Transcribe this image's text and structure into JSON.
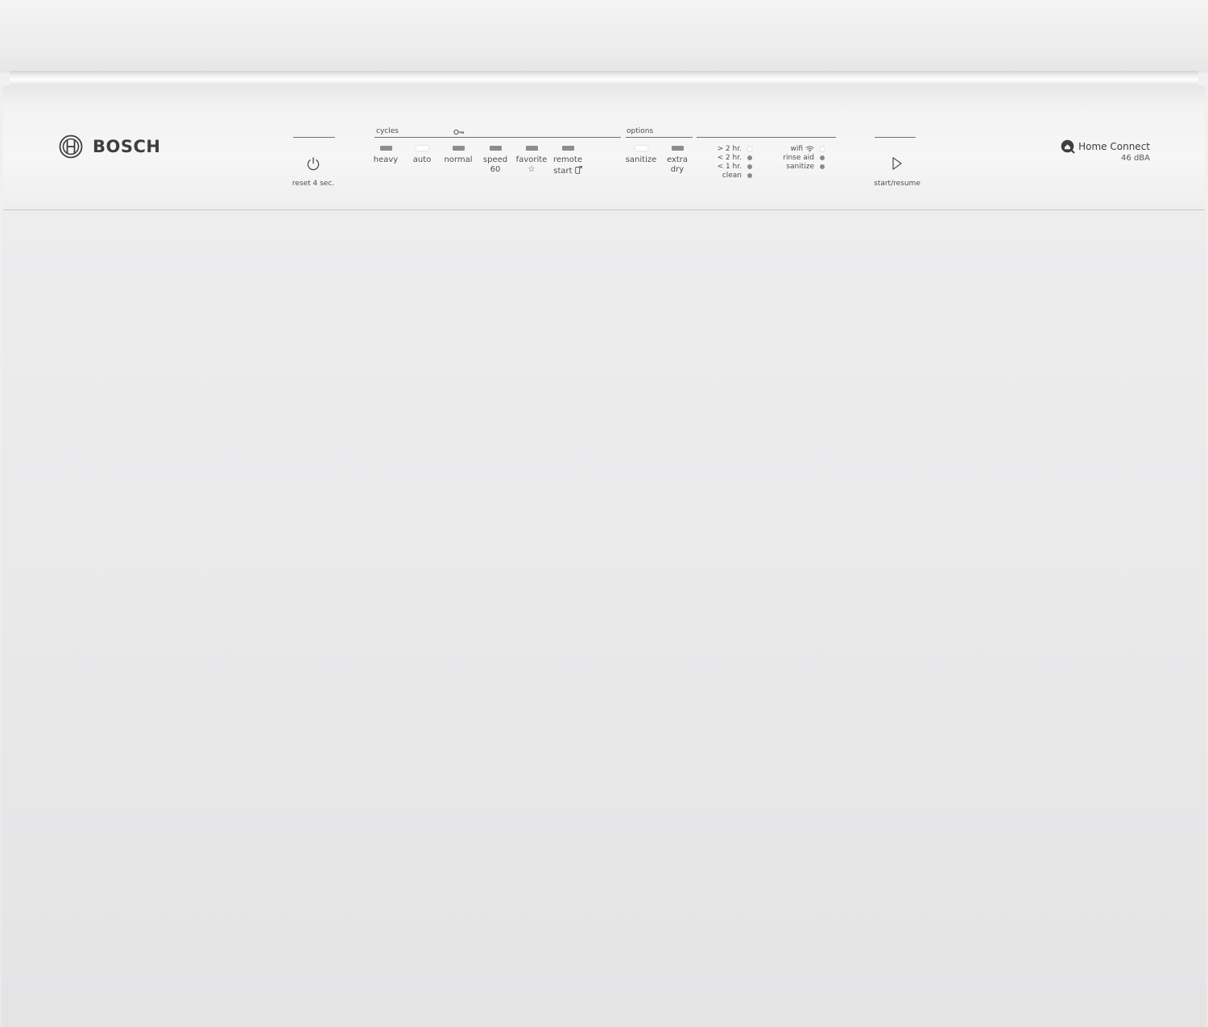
{
  "brand": {
    "name": "BOSCH",
    "logo_icon": "bosch-armature-icon"
  },
  "power_button": {
    "icon": "power-icon",
    "label": "reset 4 sec."
  },
  "cycles": {
    "heading": "cycles",
    "lock_icon": "key-icon",
    "buttons": [
      {
        "label": "heavy",
        "sub": "",
        "led_on": false
      },
      {
        "label": "auto",
        "sub": "",
        "led_on": true
      },
      {
        "label": "normal",
        "sub": "",
        "led_on": false
      },
      {
        "label": "speed",
        "sub": "60",
        "led_on": false
      },
      {
        "label": "favorite",
        "sub": "☆",
        "led_on": false
      },
      {
        "label": "remote",
        "sub": "start",
        "sub_icon": "phone-remote-icon",
        "led_on": false
      }
    ]
  },
  "options": {
    "heading": "options",
    "buttons": [
      {
        "label": "sanitize",
        "sub": "",
        "led_on": true
      },
      {
        "label": "extra",
        "sub": "dry",
        "led_on": false
      }
    ]
  },
  "time_indicators": [
    {
      "label": "> 2 hr.",
      "on": true
    },
    {
      "label": "< 2 hr.",
      "on": false
    },
    {
      "label": "< 1 hr.",
      "on": false
    },
    {
      "label": "clean",
      "on": false
    }
  ],
  "status_indicators": [
    {
      "label": "wifi",
      "icon": "wifi-icon",
      "on": true
    },
    {
      "label": "rinse aid",
      "on": false
    },
    {
      "label": "sanitize",
      "on": false
    }
  ],
  "start_button": {
    "icon": "play-icon",
    "label": "start/resume"
  },
  "homeconnect": {
    "icon": "homeconnect-icon",
    "name": "Home Connect",
    "noise_level": "46 dBA"
  },
  "colors": {
    "led_off": "#8d8d8f",
    "led_on": "#ffffff",
    "text": "#4f4f51",
    "panel": "#f3f3f4"
  }
}
